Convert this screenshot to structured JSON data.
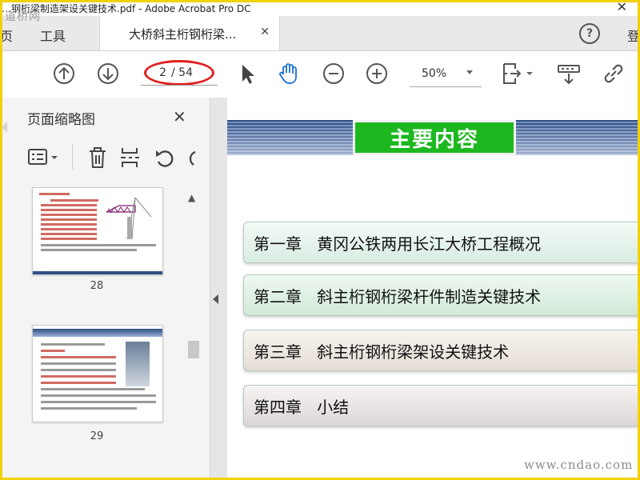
{
  "window": {
    "title": "…钢桁梁制造架设关键技术.pdf - Adobe Acrobat Pro DC",
    "close_glyph": "✕",
    "watermark": "道桥网"
  },
  "tabs": {
    "home_label": "页",
    "tools_label": "工具",
    "doc_label": "大桥斜主桁钢桁梁...",
    "doc_close": "✕",
    "help_glyph": "?",
    "signin_label": "登"
  },
  "toolbar": {
    "page_current": "2",
    "page_total": "/ 54",
    "zoom_value": "50%",
    "icons": [
      "previous-page-icon",
      "next-page-icon",
      "select-arrow-icon",
      "hand-icon",
      "zoom-out-icon",
      "zoom-in-icon",
      "page-fit-icon",
      "scroll-mode-icon",
      "link-icon"
    ]
  },
  "sidebar": {
    "title": "页面缩略图",
    "close_glyph": "✕",
    "tools": [
      "thumbnail-options-icon",
      "trash-icon",
      "extract-pages-icon",
      "undo-icon"
    ],
    "thumbnails": [
      {
        "page_label": "28"
      },
      {
        "page_label": "29"
      }
    ]
  },
  "slide": {
    "banner_title": "主要内容",
    "chapters": [
      "第一章   黄冈公铁两用长江大桥工程概况",
      "第二章   斜主桁钢桁梁杆件制造关键技术",
      "第三章   斜主桁钢桁梁架设关键技术",
      "第四章   小结"
    ],
    "watermark": "www.cndao.com"
  },
  "colors": {
    "accent_red": "#e02020",
    "banner_green": "#1db81f",
    "banner_blue": "#2f4e86",
    "frame_yellow": "#f2d100"
  }
}
